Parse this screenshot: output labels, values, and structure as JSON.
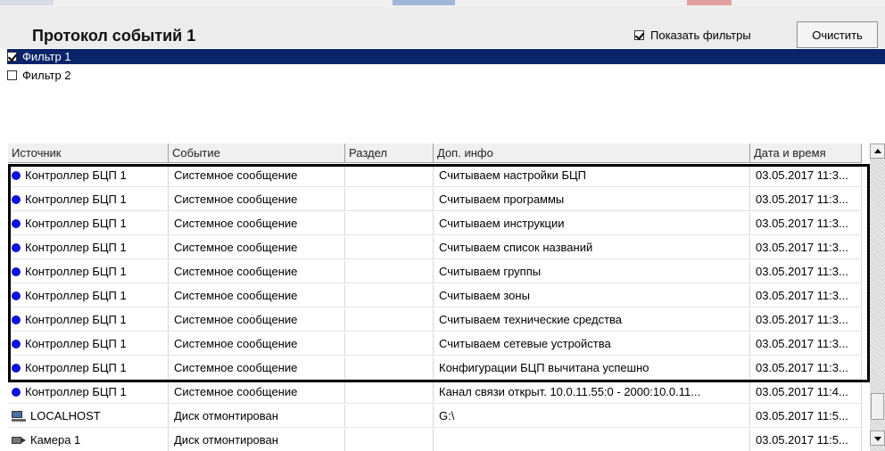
{
  "header": {
    "title": "Протокол событий 1",
    "show_filters_label": "Показать фильтры",
    "show_filters_checked": true,
    "clear_label": "Очистить"
  },
  "filters": [
    {
      "label": "Фильтр 1",
      "checked": true,
      "selected": true
    },
    {
      "label": "Фильтр 2",
      "checked": false,
      "selected": false
    }
  ],
  "table": {
    "columns": [
      "Источник",
      "Событие",
      "Раздел",
      "Доп. инфо",
      "Дата и время"
    ],
    "rows": [
      {
        "icon": "blue-dot-icon",
        "source": "Контроллер БЦП 1",
        "event": "Системное сообщение",
        "section": "",
        "info": "Считываем настройки БЦП",
        "datetime": "03.05.2017 11:3..."
      },
      {
        "icon": "blue-dot-icon",
        "source": "Контроллер БЦП 1",
        "event": "Системное сообщение",
        "section": "",
        "info": "Считываем программы",
        "datetime": "03.05.2017 11:3..."
      },
      {
        "icon": "blue-dot-icon",
        "source": "Контроллер БЦП 1",
        "event": "Системное сообщение",
        "section": "",
        "info": "Считываем инструкции",
        "datetime": "03.05.2017 11:3..."
      },
      {
        "icon": "blue-dot-icon",
        "source": "Контроллер БЦП 1",
        "event": "Системное сообщение",
        "section": "",
        "info": "Считываем список названий",
        "datetime": "03.05.2017 11:3..."
      },
      {
        "icon": "blue-dot-icon",
        "source": "Контроллер БЦП 1",
        "event": "Системное сообщение",
        "section": "",
        "info": "Считываем группы",
        "datetime": "03.05.2017 11:3..."
      },
      {
        "icon": "blue-dot-icon",
        "source": "Контроллер БЦП 1",
        "event": "Системное сообщение",
        "section": "",
        "info": "Считываем зоны",
        "datetime": "03.05.2017 11:3..."
      },
      {
        "icon": "blue-dot-icon",
        "source": "Контроллер БЦП 1",
        "event": "Системное сообщение",
        "section": "",
        "info": "Считываем технические средства",
        "datetime": "03.05.2017 11:3..."
      },
      {
        "icon": "blue-dot-icon",
        "source": "Контроллер БЦП 1",
        "event": "Системное сообщение",
        "section": "",
        "info": "Считываем сетевые устройства",
        "datetime": "03.05.2017 11:3..."
      },
      {
        "icon": "blue-dot-icon",
        "source": "Контроллер БЦП 1",
        "event": "Системное сообщение",
        "section": "",
        "info": "Конфигурации БЦП вычитана успешно",
        "datetime": "03.05.2017 11:3..."
      },
      {
        "icon": "blue-dot-icon",
        "source": "Контроллер БЦП 1",
        "event": "Системное сообщение",
        "section": "",
        "info": "Канал связи открыт. 10.0.11.55:0 - 2000:10.0.11...",
        "datetime": "03.05.2017 11:4..."
      },
      {
        "icon": "computer-icon",
        "source": "LOCALHOST",
        "event": "Диск отмонтирован",
        "section": "",
        "info": "G:\\",
        "datetime": "03.05.2017 11:5..."
      },
      {
        "icon": "camera-icon",
        "source": "Камера 1",
        "event": "Диск отмонтирован",
        "section": "",
        "info": "",
        "datetime": "03.05.2017 11:5..."
      }
    ]
  }
}
